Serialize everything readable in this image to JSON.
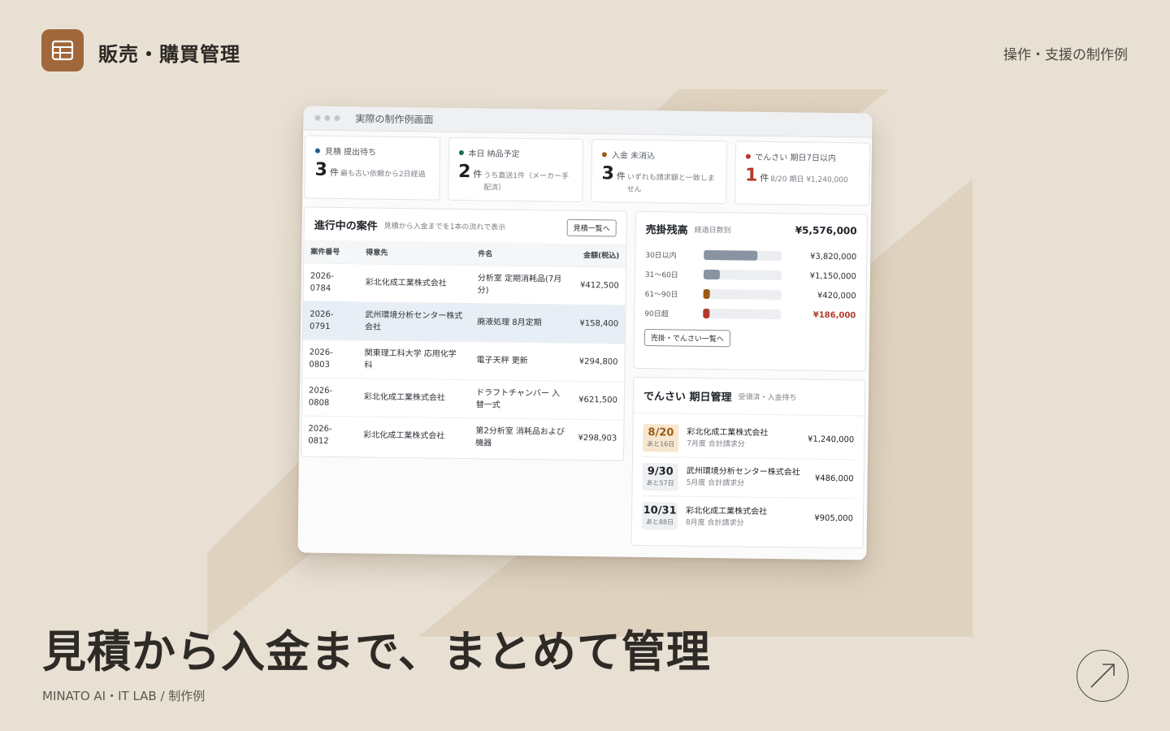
{
  "app": {
    "title": "販売・購買管理",
    "icon": "table-icon"
  },
  "header": {
    "right_text": "操作・支援の制作例"
  },
  "headline": "見積から入金まで、まとめて管理",
  "footer": "MINATO AI・IT LAB / 制作例",
  "mock": {
    "window_title": "実際の制作例画面",
    "cards": [
      {
        "label": "見積 提出待ち",
        "dot_color": "#1e5f8c",
        "num": "3",
        "unit": "件",
        "note": "最も古い依頼から2日経過",
        "num_color": "#1d2026"
      },
      {
        "label": "本日 納品予定",
        "dot_color": "#1f6e4e",
        "num": "2",
        "unit": "件",
        "note": "うち直送1件（メーカー手配済）",
        "num_color": "#1d2026"
      },
      {
        "label": "入金 未消込",
        "dot_color": "#9a5a16",
        "num": "3",
        "unit": "件",
        "note": "いずれも請求額と一致しません",
        "num_color": "#1d2026"
      },
      {
        "label": "でんさい 期日7日以内",
        "dot_color": "#b23a2c",
        "num": "1",
        "unit": "件",
        "note": "8/20 期日 ¥1,240,000",
        "num_color": "#b23a2c"
      }
    ],
    "cases": {
      "title": "進行中の案件",
      "subtitle": "見積から入金までを1本の流れで表示",
      "button": "見積一覧へ",
      "columns": [
        "案件番号",
        "得意先",
        "件名",
        "金額(税込)"
      ],
      "rows": [
        {
          "no": "2026-0784",
          "client": "彩北化成工業株式会社",
          "subject": "分析室 定期消耗品(7月分)",
          "amount": "¥412,500"
        },
        {
          "no": "2026-0791",
          "client": "武州環境分析センター株式会社",
          "subject": "廃液処理 8月定期",
          "amount": "¥158,400"
        },
        {
          "no": "2026-0803",
          "client": "関東理工科大学 応用化学科",
          "subject": "電子天秤 更新",
          "amount": "¥294,800"
        },
        {
          "no": "2026-0808",
          "client": "彩北化成工業株式会社",
          "subject": "ドラフトチャンバー 入替一式",
          "amount": "¥621,500"
        },
        {
          "no": "2026-0812",
          "client": "彩北化成工業株式会社",
          "subject": "第2分析室 消耗品および機器",
          "amount": "¥298,903"
        }
      ]
    },
    "aging": {
      "title": "売掛残高",
      "subtitle": "経過日数別",
      "total": "¥5,576,000",
      "rows": [
        {
          "label": "30日以内",
          "amount": "¥3,820,000",
          "fraction": 0.685,
          "color": "#8994a3"
        },
        {
          "label": "31〜60日",
          "amount": "¥1,150,000",
          "fraction": 0.206,
          "color": "#8994a3"
        },
        {
          "label": "61〜90日",
          "amount": "¥420,000",
          "fraction": 0.075,
          "color": "#9a5a16"
        },
        {
          "label": "90日超",
          "amount": "¥186,000",
          "fraction": 0.033,
          "color": "#b23a2c"
        }
      ],
      "button": "売掛・でんさい一覧へ"
    },
    "densai": {
      "title": "でんさい 期日管理",
      "subtitle": "受領済・入金待ち",
      "rows": [
        {
          "date": "8/20",
          "remain": "あと16日",
          "company": "彩北化成工業株式会社",
          "note": "7月度 合計請求分",
          "amount": "¥1,240,000"
        },
        {
          "date": "9/30",
          "remain": "あと57日",
          "company": "武州環境分析センター株式会社",
          "note": "5月度 合計請求分",
          "amount": "¥486,000"
        },
        {
          "date": "10/31",
          "remain": "あと88日",
          "company": "彩北化成工業株式会社",
          "note": "8月度 合計請求分",
          "amount": "¥905,000"
        }
      ]
    }
  }
}
